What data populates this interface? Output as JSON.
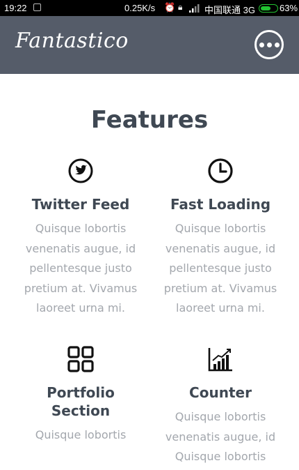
{
  "status_bar": {
    "time": "19:22",
    "net_speed": "0.25K/s",
    "carrier": "中国联通 3G",
    "battery": "63%",
    "battery_level": 0.63
  },
  "app_bar": {
    "brand": "Fantastico",
    "menu_icon": "more-horizontal-circle-icon"
  },
  "section": {
    "title": "Features"
  },
  "features": [
    {
      "icon": "twitter-icon",
      "title": "Twitter Feed",
      "desc": "Quisque lobortis venenatis augue, id pellentesque justo pretium at. Vivamus laoreet urna mi."
    },
    {
      "icon": "clock-icon",
      "title": "Fast Loading",
      "desc": "Quisque lobortis venenatis augue, id pellentesque justo pretium at. Vivamus laoreet urna mi."
    },
    {
      "icon": "grid-icon",
      "title": "Portfolio Section",
      "desc": "Quisque lobortis"
    },
    {
      "icon": "chart-icon",
      "title": "Counter",
      "desc": "Quisque lobortis venenatis augue, id Quisque lobortis"
    }
  ],
  "colors": {
    "appbar": "#555c69",
    "heading": "#3f4853",
    "body_text": "#a3a7ad"
  }
}
